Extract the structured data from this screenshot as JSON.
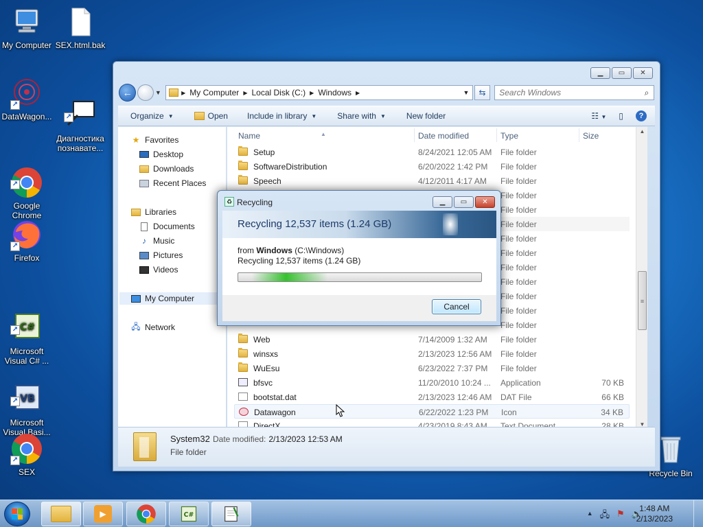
{
  "desktop": {
    "icons": [
      {
        "label": "My Computer"
      },
      {
        "label": "SEX.html.bak"
      },
      {
        "label": "DataWagon..."
      },
      {
        "label": "Диагностика\nпознавате..."
      },
      {
        "label": "Google\nChrome"
      },
      {
        "label": "Firefox"
      },
      {
        "label": "Microsoft\nVisual C# ..."
      },
      {
        "label": "Microsoft\nVisual Basi..."
      },
      {
        "label": "SEX"
      },
      {
        "label": "Recycle Bin"
      }
    ]
  },
  "explorer": {
    "breadcrumb": [
      "My Computer",
      "Local Disk (C:)",
      "Windows"
    ],
    "search_placeholder": "Search Windows",
    "toolbar": {
      "organize": "Organize",
      "open": "Open",
      "include_in_library": "Include in library",
      "share_with": "Share with",
      "new_folder": "New folder"
    },
    "nav": {
      "favorites": "Favorites",
      "desktop": "Desktop",
      "downloads": "Downloads",
      "recent_places": "Recent Places",
      "libraries": "Libraries",
      "documents": "Documents",
      "music": "Music",
      "pictures": "Pictures",
      "videos": "Videos",
      "my_computer": "My Computer",
      "network": "Network"
    },
    "columns": {
      "name": "Name",
      "date": "Date modified",
      "type": "Type",
      "size": "Size"
    },
    "rows": [
      {
        "name": "Setup",
        "date": "8/24/2021 12:05 AM",
        "type": "File folder",
        "size": ""
      },
      {
        "name": "SoftwareDistribution",
        "date": "6/20/2022 1:42 PM",
        "type": "File folder",
        "size": ""
      },
      {
        "name": "Speech",
        "date": "4/12/2011 4:17 AM",
        "type": "File folder",
        "size": ""
      },
      {
        "name": "",
        "date": "",
        "type": "File folder",
        "size": ""
      },
      {
        "name": "",
        "date": "",
        "type": "File folder",
        "size": ""
      },
      {
        "name": "",
        "date": "",
        "type": "File folder",
        "size": ""
      },
      {
        "name": "",
        "date": "",
        "type": "File folder",
        "size": ""
      },
      {
        "name": "",
        "date": "",
        "type": "File folder",
        "size": ""
      },
      {
        "name": "",
        "date": "",
        "type": "File folder",
        "size": ""
      },
      {
        "name": "",
        "date": "",
        "type": "File folder",
        "size": ""
      },
      {
        "name": "",
        "date": "",
        "type": "File folder",
        "size": ""
      },
      {
        "name": "",
        "date": "",
        "type": "File folder",
        "size": ""
      },
      {
        "name": "",
        "date": "",
        "type": "File folder",
        "size": ""
      },
      {
        "name": "Web",
        "date": "7/14/2009 1:32 AM",
        "type": "File folder",
        "size": ""
      },
      {
        "name": "winsxs",
        "date": "2/13/2023 12:56 AM",
        "type": "File folder",
        "size": ""
      },
      {
        "name": "WuEsu",
        "date": "6/23/2022 7:37 PM",
        "type": "File folder",
        "size": ""
      },
      {
        "name": "bfsvc",
        "date": "11/20/2010 10:24 ...",
        "type": "Application",
        "size": "70 KB"
      },
      {
        "name": "bootstat.dat",
        "date": "2/13/2023 12:46 AM",
        "type": "DAT File",
        "size": "66 KB"
      },
      {
        "name": "Datawagon",
        "date": "6/22/2022 1:23 PM",
        "type": "Icon",
        "size": "34 KB"
      },
      {
        "name": "DirectX",
        "date": "4/23/2019 8:43 AM",
        "type": "Text Document",
        "size": "28 KB"
      }
    ],
    "details": {
      "name": "System32",
      "modified_label": "Date modified:",
      "modified_value": "2/13/2023 12:53 AM",
      "type": "File folder"
    }
  },
  "dialog": {
    "title": "Recycling",
    "heading": "Recycling 12,537 items (1.24 GB)",
    "from_prefix": "from",
    "from_bold": "Windows",
    "from_path": "(C:\\Windows)",
    "count_line": "Recycling 12,537 items (1.24 GB)",
    "cancel": "Cancel"
  },
  "taskbar": {
    "time": "1:48 AM",
    "date": "2/13/2023"
  }
}
